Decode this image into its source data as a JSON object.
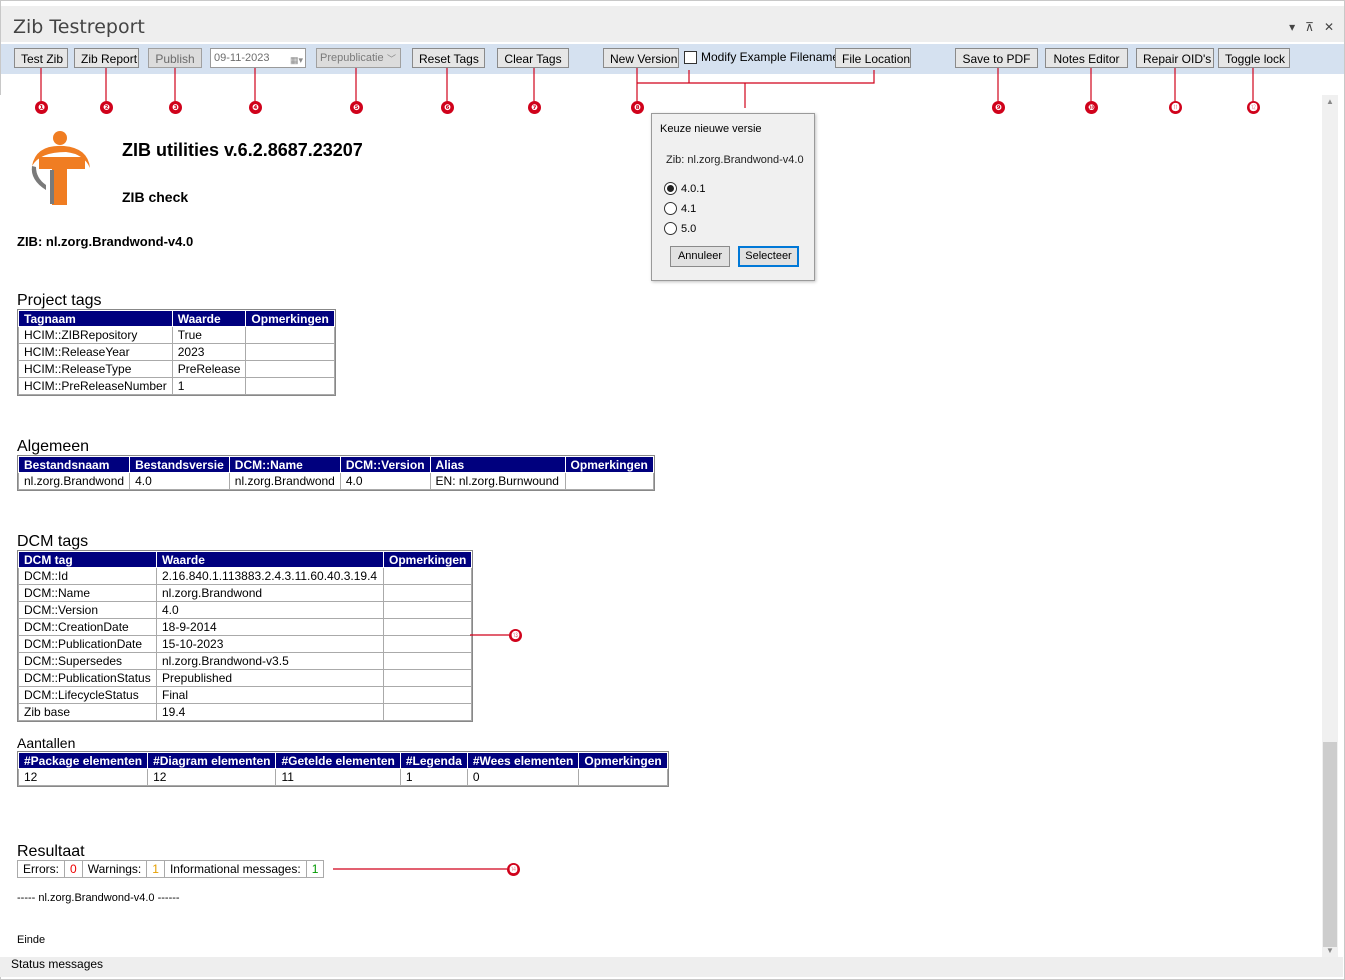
{
  "window": {
    "title": "Zib Testreport",
    "controls": {
      "dropdown": "▾",
      "pin": "⊼",
      "close": "✕"
    }
  },
  "toolbar": {
    "test_zib": "Test Zib",
    "zib_report": "Zib Report",
    "publish": "Publish",
    "date": "09-11-2023",
    "prepublicatie": "Prepublicatie",
    "reset_tags": "Reset Tags",
    "clear_tags": "Clear Tags",
    "new_version": "New Version",
    "modify_example_filename": "Modify Example Filename",
    "file_location": "File Location",
    "save_pdf": "Save to PDF",
    "notes_editor": "Notes Editor",
    "repair_oids": "Repair OID's",
    "toggle_lock": "Toggle lock"
  },
  "markers": [
    "❶",
    "❷",
    "❸",
    "❹",
    "❺",
    "❻",
    "❼",
    "❽",
    "❾",
    "❿",
    "⓫",
    "⓬",
    "⓭",
    "⓮"
  ],
  "header": {
    "title": "ZIB utilities v.6.2.8687.23207",
    "subtitle": "ZIB check",
    "zib": "ZIB: nl.zorg.Brandwond-v4.0"
  },
  "project_tags": {
    "heading": "Project tags",
    "columns": [
      "Tagnaam",
      "Waarde",
      "Opmerkingen"
    ],
    "rows": [
      [
        "HCIM::ZIBRepository",
        "True",
        ""
      ],
      [
        "HCIM::ReleaseYear",
        "2023",
        ""
      ],
      [
        "HCIM::ReleaseType",
        "PreRelease",
        ""
      ],
      [
        "HCIM::PreReleaseNumber",
        "1",
        ""
      ]
    ]
  },
  "algemeen": {
    "heading": "Algemeen",
    "columns": [
      "Bestandsnaam",
      "Bestandsversie",
      "DCM::Name",
      "DCM::Version",
      "Alias",
      "Opmerkingen"
    ],
    "rows": [
      [
        "nl.zorg.Brandwond",
        "4.0",
        "nl.zorg.Brandwond",
        "4.0",
        "EN: nl.zorg.Burnwound",
        ""
      ]
    ]
  },
  "dcm_tags": {
    "heading": "DCM tags",
    "columns": [
      "DCM tag",
      "Waarde",
      "Opmerkingen"
    ],
    "rows": [
      [
        "DCM::Id",
        "2.16.840.1.113883.2.4.3.11.60.40.3.19.4",
        ""
      ],
      [
        "DCM::Name",
        "nl.zorg.Brandwond",
        ""
      ],
      [
        "DCM::Version",
        "4.0",
        ""
      ],
      [
        "DCM::CreationDate",
        "18-9-2014",
        ""
      ],
      [
        "DCM::PublicationDate",
        "15-10-2023",
        ""
      ],
      [
        "DCM::Supersedes",
        "nl.zorg.Brandwond-v3.5",
        ""
      ],
      [
        "DCM::PublicationStatus",
        "Prepublished",
        ""
      ],
      [
        "DCM::LifecycleStatus",
        "Final",
        ""
      ],
      [
        "Zib base",
        "19.4",
        ""
      ]
    ]
  },
  "aantallen": {
    "heading": "Aantallen",
    "columns": [
      "#Package elementen",
      "#Diagram elementen",
      "#Getelde elementen",
      "#Legenda",
      "#Wees elementen",
      "Opmerkingen"
    ],
    "rows": [
      [
        "12",
        "12",
        "11",
        "1",
        "0",
        ""
      ]
    ]
  },
  "resultaat": {
    "heading": "Resultaat",
    "errors_label": "Errors:",
    "errors_value": "0",
    "warnings_label": "Warnings:",
    "warnings_value": "1",
    "info_label": "Informational messages:",
    "info_value": "1"
  },
  "footer": {
    "line1": "----- nl.zorg.Brandwond-v4.0 ------",
    "line2": "Einde"
  },
  "dialog": {
    "title": "Keuze nieuwe versie",
    "zib": "Zib: nl.zorg.Brandwond-v4.0",
    "options": [
      "4.0.1",
      "4.1",
      "5.0"
    ],
    "selected": "4.0.1",
    "cancel": "Annuleer",
    "select": "Selecteer"
  },
  "status_bar": "Status messages",
  "colors": {
    "marker": "#d0021b",
    "table_header": "#00007e",
    "toolbar_bg": "#d5e1f0",
    "errors": "#e00000",
    "warnings": "#e6a000",
    "info": "#009a00"
  }
}
